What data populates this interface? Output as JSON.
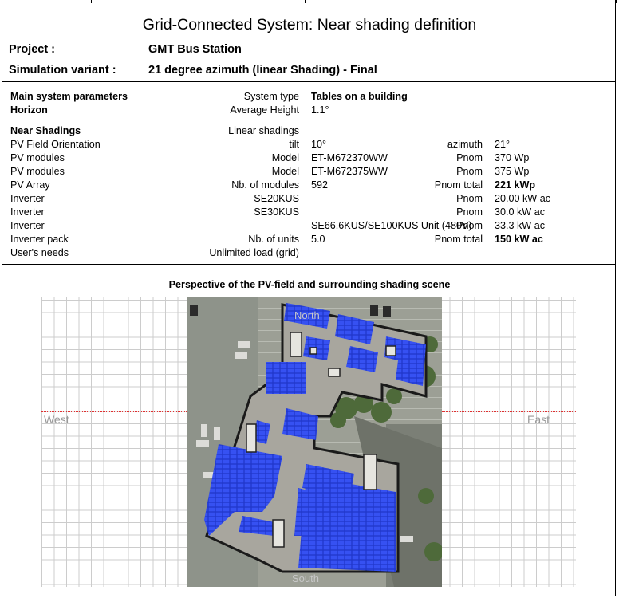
{
  "report": {
    "title": "Grid-Connected System: Near shading definition",
    "project_label": "Project :",
    "project_value": "GMT Bus Station",
    "variant_label": "Simulation variant :",
    "variant_value": "21 degree azimuth (linear Shading) - Final"
  },
  "params": {
    "main_label": "Main system parameters",
    "horizon_label": "Horizon",
    "system_type_label": "System type",
    "system_type_value": "Tables on a building",
    "avg_height_label": "Average Height",
    "avg_height_value": "1.1°",
    "near_shadings_label": "Near Shadings",
    "near_shadings_value": "Linear shadings",
    "rows": [
      {
        "label": "PV Field Orientation",
        "mid_label": "tilt",
        "mid_value": "10°",
        "right_label": "azimuth",
        "right_value": "21°"
      },
      {
        "label": "PV modules",
        "mid_label": "Model",
        "mid_value": "ET-M672370WW",
        "right_label": "Pnom",
        "right_value": "370 Wp"
      },
      {
        "label": "PV modules",
        "mid_label": "Model",
        "mid_value": "ET-M672375WW",
        "right_label": "Pnom",
        "right_value": "375 Wp"
      },
      {
        "label": "PV Array",
        "mid_label": "Nb. of modules",
        "mid_value": "592",
        "right_label": "Pnom total",
        "right_value": "221 kWp"
      },
      {
        "label": "Inverter",
        "mid_label": "SE20KUS",
        "mid_value": "",
        "right_label": "Pnom",
        "right_value": "20.00 kW ac"
      },
      {
        "label": "Inverter",
        "mid_label": "SE30KUS",
        "mid_value": "",
        "right_label": "Pnom",
        "right_value": "30.0 kW ac"
      },
      {
        "label": "Inverter",
        "mid_label": "",
        "mid_value": "SE66.6KUS/SE100KUS Unit (480V)",
        "right_label": "Pnom",
        "right_value": "33.3 kW ac"
      },
      {
        "label": "Inverter pack",
        "mid_label": "Nb. of units",
        "mid_value": "5.0",
        "right_label": "Pnom total",
        "right_value": "150 kW ac"
      },
      {
        "label": "User's needs",
        "mid_label": "Unlimited load (grid)",
        "mid_value": "",
        "right_label": "",
        "right_value": ""
      }
    ]
  },
  "perspective": {
    "title": "Perspective of the PV-field and surrounding shading scene",
    "west": "West",
    "east": "East",
    "north": "North",
    "south": "South",
    "colors": {
      "panel": "#2d4cf0",
      "horizon": "#e03030",
      "grid": "#cccccc"
    }
  }
}
